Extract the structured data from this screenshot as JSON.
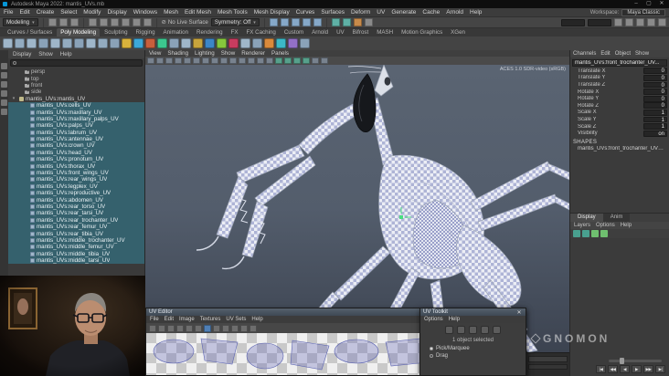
{
  "window": {
    "title": "Autodesk Maya 2022: mantis_UVs.mb",
    "workspace_label": "Workspace:",
    "workspace_value": "Maya Classic",
    "minimize": "–",
    "maximize": "▢",
    "close": "✕"
  },
  "colors": {
    "outliner_selection": "#35616d",
    "viewport_gradient_top": "#5a6472",
    "viewport_gradient_bottom": "#3c4350",
    "uv_accent": "#4f7fb5",
    "manipulator_green": "#4ade80"
  },
  "menubar": {
    "items": [
      "File",
      "Edit",
      "Create",
      "Select",
      "Modify",
      "Display",
      "Windows",
      "Mesh",
      "Edit Mesh",
      "Mesh Tools",
      "Mesh Display",
      "Curves",
      "Surfaces",
      "Deform",
      "UV",
      "Generate",
      "Cache",
      "Arnold",
      "Help"
    ]
  },
  "statusline": {
    "mode": "Modeling",
    "no_live_surface": "No Live Surface",
    "symmetry": "Symmetry: Off",
    "file_icons": [
      {
        "name": "new-scene-icon",
        "color": "#8a8a8a"
      },
      {
        "name": "open-scene-icon",
        "color": "#8a8a8a"
      },
      {
        "name": "save-scene-icon",
        "color": "#8a8a8a"
      }
    ],
    "mask_icons": [
      {
        "name": "select-by-hierarchy-icon",
        "color": "#8a8a8a"
      },
      {
        "name": "select-by-object-type-icon",
        "color": "#8a8a8a"
      },
      {
        "name": "select-by-component-type-icon",
        "color": "#8a8a8a"
      },
      {
        "name": "select-mesh-icon",
        "color": "#8a8a8a"
      },
      {
        "name": "select-curve-icon",
        "color": "#8a8a8a"
      },
      {
        "name": "select-surface-icon",
        "color": "#8a8a8a"
      }
    ],
    "snap_icons": [
      {
        "name": "snap-to-grid-icon",
        "color": "#86a8c8"
      },
      {
        "name": "snap-to-curve-icon",
        "color": "#86a8c8"
      },
      {
        "name": "snap-to-point-icon",
        "color": "#86a8c8"
      },
      {
        "name": "snap-to-projected-center-icon",
        "color": "#86a8c8"
      },
      {
        "name": "snap-to-view-plane-icon",
        "color": "#86a8c8"
      }
    ],
    "render_icons": [
      {
        "name": "render-view-icon",
        "color": "#5fb0a5"
      },
      {
        "name": "render-current-frame-icon",
        "color": "#5fb0a5"
      },
      {
        "name": "ipr-render-icon",
        "color": "#c78a4a"
      },
      {
        "name": "render-settings-icon",
        "color": "#8a8a8a"
      }
    ],
    "right_icons": [
      {
        "name": "highlight-selection-mode-icon",
        "color": "#8a8a8a"
      },
      {
        "name": "object-details-icon",
        "color": "#8a8a8a"
      },
      {
        "name": "channel-box-icon",
        "color": "#8a8a8a"
      },
      {
        "name": "attribute-editor-icon",
        "color": "#8a8a8a"
      },
      {
        "name": "tool-settings-icon",
        "color": "#8a8a8a"
      }
    ]
  },
  "shelf": {
    "tabs": [
      {
        "label": "Curves / Surfaces",
        "active": false
      },
      {
        "label": "Poly Modeling",
        "active": true
      },
      {
        "label": "Sculpting",
        "active": false
      },
      {
        "label": "Rigging",
        "active": false
      },
      {
        "label": "Animation",
        "active": false
      },
      {
        "label": "Rendering",
        "active": false
      },
      {
        "label": "FX",
        "active": false
      },
      {
        "label": "FX Caching",
        "active": false
      },
      {
        "label": "Custom",
        "active": false
      },
      {
        "label": "Arnold",
        "active": false
      },
      {
        "label": "UV",
        "active": false
      },
      {
        "label": "Bifrost",
        "active": false
      },
      {
        "label": "MASH",
        "active": false
      },
      {
        "label": "Motion Graphics",
        "active": false
      },
      {
        "label": "XGen",
        "active": false
      }
    ],
    "icons": [
      {
        "name": "polygon-sphere-icon",
        "color": "#9fb6c9"
      },
      {
        "name": "polygon-cube-icon",
        "color": "#93abc0"
      },
      {
        "name": "polygon-cylinder-icon",
        "color": "#9fb6c9"
      },
      {
        "name": "polygon-cone-icon",
        "color": "#8aa2b8"
      },
      {
        "name": "polygon-torus-icon",
        "color": "#9fb6c9"
      },
      {
        "name": "polygon-plane-icon",
        "color": "#93abc0"
      },
      {
        "name": "polygon-disc-icon",
        "color": "#8aa2b8"
      },
      {
        "name": "platonic-solid-icon",
        "color": "#9fb6c9"
      },
      {
        "name": "polygon-pyramid-icon",
        "color": "#93abc0"
      },
      {
        "name": "polygon-pipe-icon",
        "color": "#8aa2b8"
      },
      {
        "name": "polygon-helix-icon",
        "color": "#d9b23c"
      },
      {
        "name": "polygon-gear-icon",
        "color": "#3ca8d9"
      },
      {
        "name": "soccer-ball-icon",
        "color": "#c75f3c"
      },
      {
        "name": "super-ellipse-icon",
        "color": "#3cc78f"
      },
      {
        "name": "sculpt-tool-icon",
        "color": "#8aa2b8"
      },
      {
        "name": "boolean-union-icon",
        "color": "#9fb6c9"
      },
      {
        "name": "boolean-difference-icon",
        "color": "#c7a43c"
      },
      {
        "name": "boolean-intersection-icon",
        "color": "#3c86c7"
      },
      {
        "name": "combine-icon",
        "color": "#86c73c"
      },
      {
        "name": "separate-icon",
        "color": "#c73c5f"
      },
      {
        "name": "extrude-icon",
        "color": "#9fb6c9"
      },
      {
        "name": "bevel-icon",
        "color": "#8aa2b8"
      },
      {
        "name": "bridge-icon",
        "color": "#d98a3c"
      },
      {
        "name": "multi-cut-icon",
        "color": "#3cb8c7"
      },
      {
        "name": "target-weld-icon",
        "color": "#9370c7"
      },
      {
        "name": "quad-draw-icon",
        "color": "#8aa2b8"
      }
    ]
  },
  "toolbox": {
    "icons": [
      "select-tool-icon",
      "lasso-tool-icon",
      "paint-select-tool-icon",
      "move-tool-icon",
      "rotate-tool-icon",
      "scale-tool-icon"
    ]
  },
  "outliner": {
    "menus": [
      "Display",
      "Show",
      "Help"
    ],
    "cameras": [
      "persp",
      "top",
      "front",
      "side"
    ],
    "group_label": "mantis_UVs:mantis_UV",
    "items": [
      "mantis_UVs:cells_UV",
      "mantis_UVs:maxillary_UV",
      "mantis_UVs:maxillary_palps_UV",
      "mantis_UVs:palps_UV",
      "mantis_UVs:labrum_UV",
      "mantis_UVs:antennae_UV",
      "mantis_UVs:crown_UV",
      "mantis_UVs:head_UV",
      "mantis_UVs:pronotum_UV",
      "mantis_UVs:thorax_UV",
      "mantis_UVs:front_wings_UV",
      "mantis_UVs:rear_wings_UV",
      "mantis_UVs:legplex_UV",
      "mantis_UVs:reproductive_UV",
      "mantis_UVs:abdomen_UV",
      "mantis_UVs:rear_torso_UV",
      "mantis_UVs:rear_tarsi_UV",
      "mantis_UVs:rear_trochanter_UV",
      "mantis_UVs:rear_femur_UV",
      "mantis_UVs:rear_tibia_UV",
      "mantis_UVs:middle_trochanter_UV",
      "mantis_UVs:middle_femur_UV",
      "mantis_UVs:middle_tibia_UV",
      "mantis_UVs:middle_tarsi_UV"
    ]
  },
  "viewport": {
    "menus": [
      "View",
      "Shading",
      "Lighting",
      "Show",
      "Renderer",
      "Panels"
    ],
    "colorspace": "ACES 1.0 SDR-video (sRGB)",
    "toolbar_icons": [
      {
        "name": "select-camera-icon",
        "color": "#78828e"
      },
      {
        "name": "lock-camera-icon",
        "color": "#78828e"
      },
      {
        "name": "camera-attributes-icon",
        "color": "#78828e"
      },
      {
        "name": "bookmark-icon",
        "color": "#78828e"
      },
      {
        "name": "image-plane-icon",
        "color": "#78828e"
      },
      {
        "name": "two-d-pan-zoom-icon",
        "color": "#78828e"
      },
      {
        "name": "grease-pencil-icon",
        "color": "#78828e"
      },
      {
        "name": "grid-icon",
        "color": "#78828e"
      },
      {
        "name": "film-gate-icon",
        "color": "#78828e"
      },
      {
        "name": "resolution-gate-icon",
        "color": "#78828e"
      },
      {
        "name": "gate-mask-icon",
        "color": "#78828e"
      },
      {
        "name": "field-chart-icon",
        "color": "#78828e"
      },
      {
        "name": "safe-action-icon",
        "color": "#78828e"
      },
      {
        "name": "safe-title-icon",
        "color": "#78828e"
      },
      {
        "name": "frame-all-icon",
        "color": "#57a08b"
      },
      {
        "name": "frame-selection-icon",
        "color": "#57a08b"
      },
      {
        "name": "isolate-select-icon",
        "color": "#57a08b"
      },
      {
        "name": "xray-icon",
        "color": "#57a08b"
      },
      {
        "name": "wireframe-on-shaded-icon",
        "color": "#78828e"
      },
      {
        "name": "textured-icon",
        "color": "#78828e"
      }
    ]
  },
  "channelbox": {
    "menus": [
      "Channels",
      "Edit",
      "Object",
      "Show"
    ],
    "object_name": "mantis_UVs:front_trochanter_UV...",
    "attributes": [
      {
        "label": "Translate X",
        "value": "0"
      },
      {
        "label": "Translate Y",
        "value": "0"
      },
      {
        "label": "Translate Z",
        "value": "0"
      },
      {
        "label": "Rotate X",
        "value": "0"
      },
      {
        "label": "Rotate Y",
        "value": "0"
      },
      {
        "label": "Rotate Z",
        "value": "0"
      },
      {
        "label": "Scale X",
        "value": "1"
      },
      {
        "label": "Scale Y",
        "value": "1"
      },
      {
        "label": "Scale Z",
        "value": "1"
      },
      {
        "label": "Visibility",
        "value": "on"
      }
    ],
    "shapes_label": "SHAPES",
    "shape_name": "mantis_UVs:front_trochanter_UVSh..."
  },
  "layers": {
    "tabs": [
      {
        "label": "Display",
        "active": true
      },
      {
        "label": "Anim",
        "active": false
      }
    ],
    "menus": [
      "Layers",
      "Options",
      "Help"
    ],
    "toolbar_icons": [
      {
        "name": "move-layer-up-icon",
        "color": "#49a08f"
      },
      {
        "name": "move-layer-down-icon",
        "color": "#49a08f"
      },
      {
        "name": "create-empty-layer-icon",
        "color": "#6fbf6f"
      },
      {
        "name": "create-layer-from-selected-icon",
        "color": "#6fbf6f"
      }
    ]
  },
  "uv_editor": {
    "title": "UV Editor",
    "menus": [
      "File",
      "Edit",
      "Image",
      "Textures",
      "UV Sets",
      "Help"
    ],
    "toolbar_icons": [
      {
        "name": "uv-distortion-icon",
        "color": "#6d6d6d"
      },
      {
        "name": "checker-map-icon",
        "color": "#6d6d6d"
      },
      {
        "name": "uv-grid-icon",
        "color": "#6d6d6d"
      },
      {
        "name": "dim-image-icon",
        "color": "#6d6d6d"
      },
      {
        "name": "view-grid-icon",
        "color": "#6d6d6d"
      },
      {
        "name": "pixel-snap-icon",
        "color": "#6d6d6d"
      },
      {
        "name": "shade-uvs-icon",
        "color": "#4f7fb5"
      },
      {
        "name": "texture-borders-icon",
        "color": "#6d6d6d"
      },
      {
        "name": "uv-baking-icon",
        "color": "#6d6d6d"
      },
      {
        "name": "isolate-select-uv-icon",
        "color": "#6d6d6d"
      },
      {
        "name": "uv-snapshot-icon",
        "color": "#6d6d6d"
      },
      {
        "name": "tile-view-icon",
        "color": "#6d6d6d"
      }
    ]
  },
  "uv_toolkit": {
    "title": "UV Toolkit",
    "menus": [
      "Options",
      "Help"
    ],
    "tool_icons": [
      "uv-move-tool-icon",
      "uv-rotate-tool-icon",
      "uv-scale-tool-icon",
      "uv-lattice-tool-icon",
      "uv-symmetry-icon"
    ],
    "status": "1 object selected",
    "modes": [
      {
        "label": "Pick/Marquee",
        "selected": true
      },
      {
        "label": "Drag",
        "selected": false
      }
    ]
  },
  "transport": {
    "buttons": [
      {
        "name": "go-to-start-icon",
        "glyph": "|◀"
      },
      {
        "name": "step-back-icon",
        "glyph": "◀◀"
      },
      {
        "name": "play-backwards-icon",
        "glyph": "◀"
      },
      {
        "name": "play-forwards-icon",
        "glyph": "▶"
      },
      {
        "name": "step-forward-icon",
        "glyph": "▶▶"
      },
      {
        "name": "go-to-end-icon",
        "glyph": "▶|"
      }
    ]
  },
  "watermark": {
    "text": "GNOMON"
  }
}
